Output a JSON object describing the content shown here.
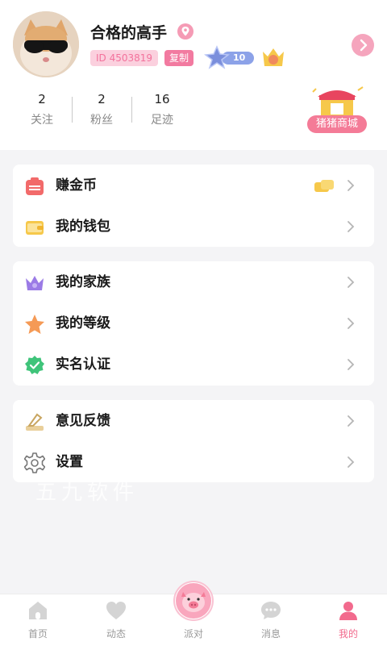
{
  "profile": {
    "username": "合格的高手",
    "id_text": "ID 4503819",
    "copy_label": "复制",
    "level": "10",
    "stats": [
      {
        "value": "2",
        "label": "关注"
      },
      {
        "value": "2",
        "label": "粉丝"
      },
      {
        "value": "16",
        "label": "足迹"
      }
    ],
    "mall_label": "猪猪商城"
  },
  "menu_groups": [
    [
      {
        "label": "赚金币",
        "icon": "coin-bag-icon"
      },
      {
        "label": "我的钱包",
        "icon": "wallet-icon"
      }
    ],
    [
      {
        "label": "我的家族",
        "icon": "crown-icon"
      },
      {
        "label": "我的等级",
        "icon": "star-icon"
      },
      {
        "label": "实名认证",
        "icon": "verified-icon"
      }
    ],
    [
      {
        "label": "意见反馈",
        "icon": "feedback-icon"
      },
      {
        "label": "设置",
        "icon": "gear-icon"
      }
    ]
  ],
  "watermark": "五九软件",
  "tabs": [
    {
      "label": "首页",
      "icon": "home-icon"
    },
    {
      "label": "动态",
      "icon": "heart-icon"
    },
    {
      "label": "派对",
      "icon": "party-pig-icon"
    },
    {
      "label": "消息",
      "icon": "message-icon"
    },
    {
      "label": "我的",
      "icon": "profile-icon",
      "active": true
    }
  ],
  "colors": {
    "accent": "#f26a8d",
    "background": "#f4f4f6"
  }
}
